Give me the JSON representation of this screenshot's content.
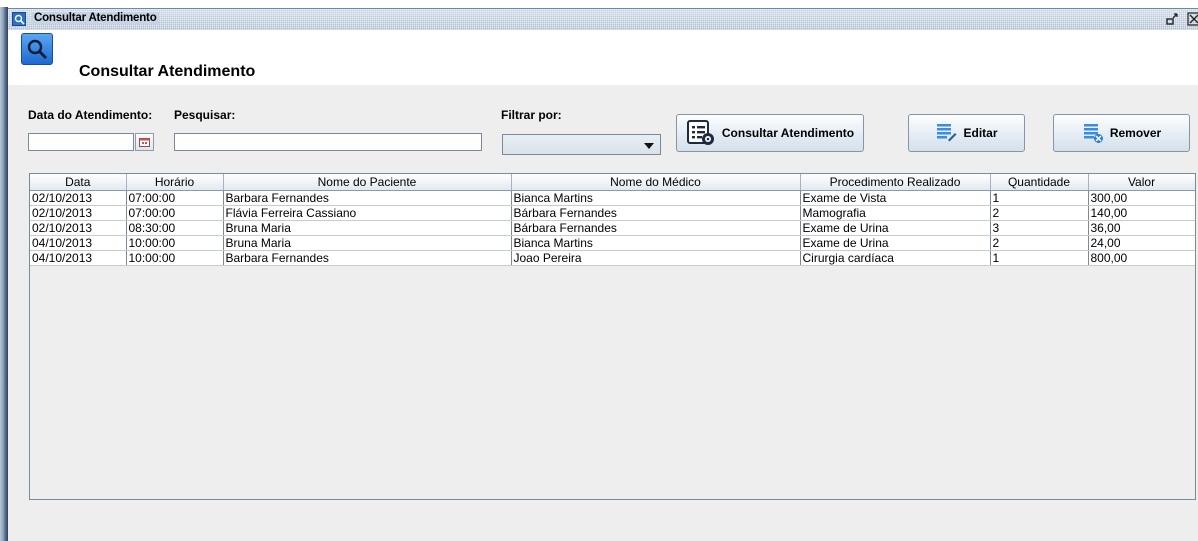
{
  "window": {
    "title": "Consultar Atendimento"
  },
  "header": {
    "title": "Consultar Atendimento",
    "icon": "search-icon"
  },
  "filters": {
    "date_label": "Data do Atendimento:",
    "date_value": "",
    "search_label": "Pesquisar:",
    "search_value": "",
    "filter_label": "Filtrar por:",
    "filter_value": ""
  },
  "buttons": {
    "consultar": "Consultar Atendimento",
    "editar": "Editar",
    "remover": "Remover"
  },
  "table": {
    "columns": [
      "Data",
      "Horário",
      "Nome do Paciente",
      "Nome do Médico",
      "Procedimento Realizado",
      "Quantidade",
      "Valor"
    ],
    "rows": [
      [
        "02/10/2013",
        "07:00:00",
        "Barbara Fernandes",
        "Bianca Martins",
        "Exame de Vista",
        "1",
        "300,00"
      ],
      [
        "02/10/2013",
        "07:00:00",
        "Flávia Ferreira Cassiano",
        "Bárbara Fernandes",
        "Mamografia",
        "2",
        "140,00"
      ],
      [
        "02/10/2013",
        "08:30:00",
        "Bruna Maria",
        "Bárbara Fernandes",
        "Exame de Urina",
        "3",
        "36,00"
      ],
      [
        "04/10/2013",
        "10:00:00",
        "Bruna Maria",
        "Bianca Martins",
        "Exame de Urina",
        "2",
        "24,00"
      ],
      [
        "04/10/2013",
        "10:00:00",
        "Barbara Fernandes",
        "Joao Pereira",
        "Cirurgia cardíaca",
        "1",
        "800,00"
      ]
    ]
  }
}
